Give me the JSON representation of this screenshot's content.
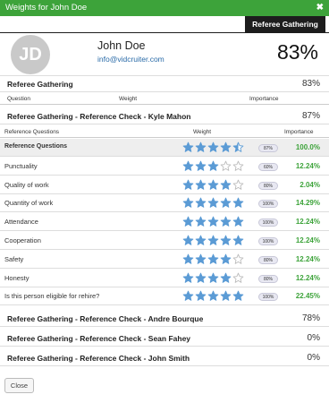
{
  "window": {
    "title": "Weights for John Doe",
    "close_glyph": "✖"
  },
  "tab": {
    "label": "Referee Gathering"
  },
  "profile": {
    "initials": "JD",
    "name": "John Doe",
    "email": "info@vidcruiter.com",
    "score": "83%"
  },
  "summary": {
    "label": "Referee Gathering",
    "score": "83%"
  },
  "weights_header": {
    "question": "Question",
    "weight": "Weight",
    "importance": "Importance"
  },
  "check1": {
    "label": "Referee Gathering - Reference Check - Kyle Mahon",
    "score": "87%"
  },
  "questions_header": {
    "question": "Reference Questions",
    "weight": "Weight",
    "importance": "Importance"
  },
  "rows": [
    {
      "question": "Reference Questions",
      "rating": 4.5,
      "weight": "87%",
      "importance": "100.0%"
    },
    {
      "question": "Punctuality",
      "rating": 3,
      "weight": "60%",
      "importance": "12.24%"
    },
    {
      "question": "Quality of work",
      "rating": 4,
      "weight": "80%",
      "importance": "2.04%"
    },
    {
      "question": "Quantity of work",
      "rating": 5,
      "weight": "100%",
      "importance": "14.29%"
    },
    {
      "question": "Attendance",
      "rating": 5,
      "weight": "100%",
      "importance": "12.24%"
    },
    {
      "question": "Cooperation",
      "rating": 5,
      "weight": "100%",
      "importance": "12.24%"
    },
    {
      "question": "Safety",
      "rating": 4,
      "weight": "80%",
      "importance": "12.24%"
    },
    {
      "question": "Honesty",
      "rating": 4,
      "weight": "80%",
      "importance": "12.24%"
    },
    {
      "question": "Is this person eligible for rehire?",
      "rating": 5,
      "weight": "100%",
      "importance": "22.45%"
    }
  ],
  "check2": {
    "label": "Referee Gathering - Reference Check - Andre Bourque",
    "score": "78%"
  },
  "check3": {
    "label": "Referee Gathering - Reference Check - Sean Fahey",
    "score": "0%"
  },
  "check4": {
    "label": "Referee Gathering - Reference Check - John Smith",
    "score": "0%"
  },
  "buttons": {
    "close": "Close"
  },
  "colors": {
    "title_bar": "#3da33a",
    "star_filled": "#5b9bd5",
    "star_empty": "#bbbbbb",
    "importance_text": "#3da33a"
  }
}
